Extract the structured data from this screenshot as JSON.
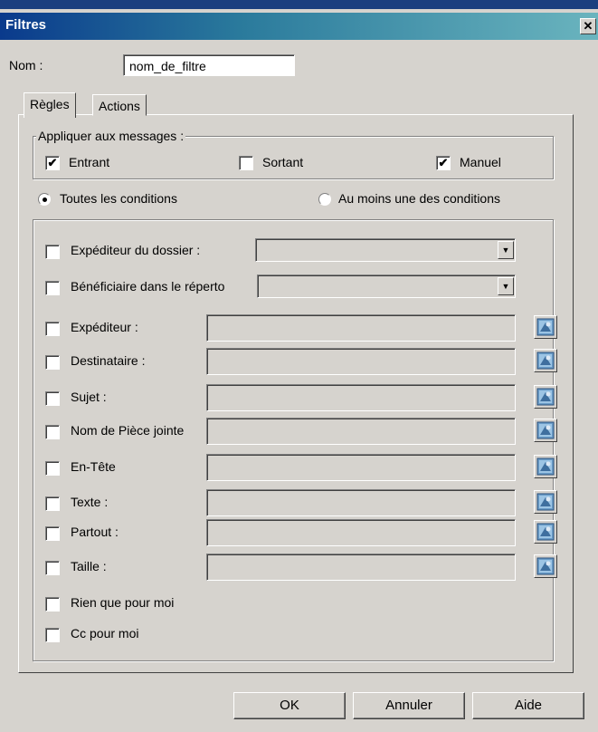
{
  "window": {
    "title": "Filtres",
    "close_glyph": "✕"
  },
  "name": {
    "label": "Nom :",
    "value": "nom_de_filtre"
  },
  "tabs": [
    {
      "label": "Règles"
    },
    {
      "label": "Actions"
    }
  ],
  "apply": {
    "legend": "Appliquer aux messages :",
    "options": [
      {
        "label": "Entrant",
        "checked": true
      },
      {
        "label": "Sortant",
        "checked": false
      },
      {
        "label": "Manuel",
        "checked": true
      }
    ]
  },
  "match": {
    "all": {
      "label": "Toutes les conditions",
      "selected": true
    },
    "any": {
      "label": "Au moins une des conditions",
      "selected": false
    }
  },
  "conditions": [
    {
      "label": "Expéditeur du dossier :",
      "type": "dropdown"
    },
    {
      "label": "Bénéficiaire dans le réperto",
      "type": "dropdown"
    },
    {
      "label": "Expéditeur :",
      "type": "text"
    },
    {
      "label": "Destinataire :",
      "type": "text"
    },
    {
      "label": "Sujet :",
      "type": "text"
    },
    {
      "label": "Nom de Pièce jointe",
      "type": "text"
    },
    {
      "label": "En-Tête",
      "type": "text"
    },
    {
      "label": "Texte :",
      "type": "text"
    },
    {
      "label": "Partout :",
      "type": "text"
    },
    {
      "label": "Taille :",
      "type": "text"
    },
    {
      "label": "Rien que pour moi",
      "type": "checkbox"
    },
    {
      "label": "Cc pour moi",
      "type": "checkbox"
    }
  ],
  "buttons": {
    "ok": "OK",
    "cancel": "Annuler",
    "help": "Aide"
  },
  "glyphs": {
    "check": "✔",
    "dropdown": "▼"
  },
  "icons": {
    "address_book": "address-book-icon"
  }
}
